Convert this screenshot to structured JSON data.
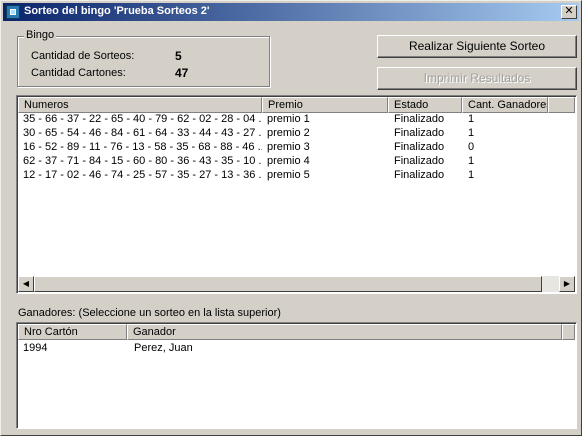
{
  "window": {
    "title": "Sorteo del bingo 'Prueba Sorteos 2'",
    "close_glyph": "✕"
  },
  "bingo": {
    "legend": "Bingo",
    "sorteos_label": "Cantidad de Sorteos:",
    "sorteos_value": "5",
    "cartones_label": "Cantidad Cartones:",
    "cartones_value": "47"
  },
  "actions": {
    "next_draw": "Realizar Siguiente Sorteo",
    "print_results": "Imprimir Resultados"
  },
  "sorteos_table": {
    "columns": [
      "Numeros",
      "Premio",
      "Estado",
      "Cant. Ganadores"
    ],
    "rows": [
      [
        "35 - 66 - 37 - 22 - 65 - 40 - 79 - 62 - 02 - 28 - 04 ...",
        "premio 1",
        "Finalizado",
        "1"
      ],
      [
        "30 - 65 - 54 - 46 - 84 - 61 - 64 - 33 - 44 - 43 - 27 ...",
        "premio 2",
        "Finalizado",
        "1"
      ],
      [
        "16 - 52 - 89 - 11 - 76 - 13 - 58 - 35 - 68 - 88 - 46 ...",
        "premio 3",
        "Finalizado",
        "0"
      ],
      [
        "62 - 37 - 71 - 84 - 15 - 60 - 80 - 36 - 43 - 35 - 10 ...",
        "premio 4",
        "Finalizado",
        "1"
      ],
      [
        "12 - 17 - 02 - 46 - 74 - 25 - 57 - 35 - 27 - 13 - 36 ...",
        "premio 5",
        "Finalizado",
        "1"
      ]
    ]
  },
  "scrollbar": {
    "left_arrow": "◀",
    "right_arrow": "▶"
  },
  "ganadores": {
    "label": "Ganadores: (Seleccione un sorteo en la lista superior)",
    "columns": [
      "Nro Cartón",
      "Ganador"
    ],
    "rows": [
      [
        "1994",
        "Perez, Juan"
      ]
    ]
  }
}
